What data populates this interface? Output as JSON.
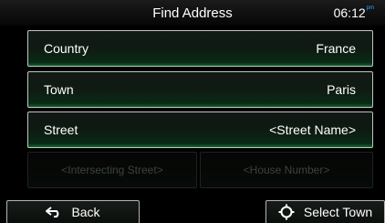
{
  "header": {
    "title": "Find Address",
    "time": "06:12",
    "ampm": "pm"
  },
  "fields": {
    "country": {
      "label": "Country",
      "value": "France"
    },
    "town": {
      "label": "Town",
      "value": "Paris"
    },
    "street": {
      "label": "Street",
      "value": "<Street Name>"
    },
    "intersecting_street": "<Intersecting Street>",
    "house_number": "<House Number>"
  },
  "footer": {
    "back_label": "Back",
    "select_town_label": "Select Town"
  },
  "icons": {
    "back": "back-arrow-icon",
    "select": "crosshair-icon"
  },
  "colors": {
    "accent": "#3aa3ff",
    "button_glow": "#14602b"
  }
}
